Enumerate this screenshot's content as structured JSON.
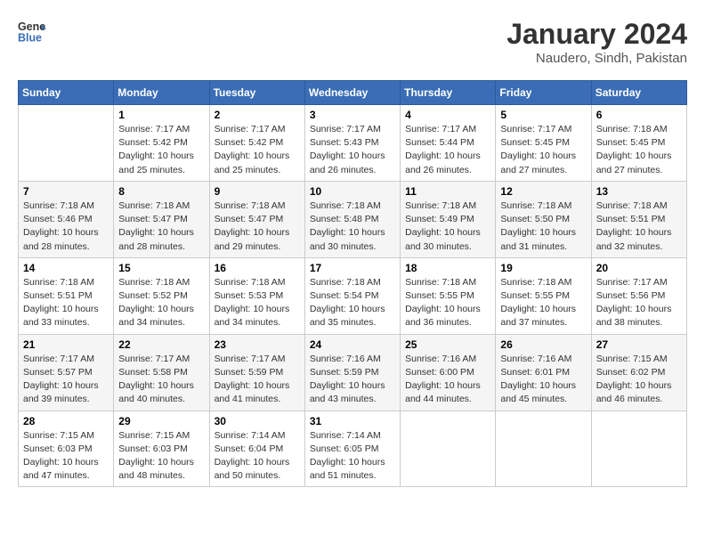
{
  "header": {
    "logo": {
      "general": "General",
      "blue": "Blue"
    },
    "title": "January 2024",
    "location": "Naudero, Sindh, Pakistan"
  },
  "weekdays": [
    "Sunday",
    "Monday",
    "Tuesday",
    "Wednesday",
    "Thursday",
    "Friday",
    "Saturday"
  ],
  "weeks": [
    [
      {
        "day": "",
        "info": ""
      },
      {
        "day": "1",
        "info": "Sunrise: 7:17 AM\nSunset: 5:42 PM\nDaylight: 10 hours\nand 25 minutes."
      },
      {
        "day": "2",
        "info": "Sunrise: 7:17 AM\nSunset: 5:42 PM\nDaylight: 10 hours\nand 25 minutes."
      },
      {
        "day": "3",
        "info": "Sunrise: 7:17 AM\nSunset: 5:43 PM\nDaylight: 10 hours\nand 26 minutes."
      },
      {
        "day": "4",
        "info": "Sunrise: 7:17 AM\nSunset: 5:44 PM\nDaylight: 10 hours\nand 26 minutes."
      },
      {
        "day": "5",
        "info": "Sunrise: 7:17 AM\nSunset: 5:45 PM\nDaylight: 10 hours\nand 27 minutes."
      },
      {
        "day": "6",
        "info": "Sunrise: 7:18 AM\nSunset: 5:45 PM\nDaylight: 10 hours\nand 27 minutes."
      }
    ],
    [
      {
        "day": "7",
        "info": "Sunrise: 7:18 AM\nSunset: 5:46 PM\nDaylight: 10 hours\nand 28 minutes."
      },
      {
        "day": "8",
        "info": "Sunrise: 7:18 AM\nSunset: 5:47 PM\nDaylight: 10 hours\nand 28 minutes."
      },
      {
        "day": "9",
        "info": "Sunrise: 7:18 AM\nSunset: 5:47 PM\nDaylight: 10 hours\nand 29 minutes."
      },
      {
        "day": "10",
        "info": "Sunrise: 7:18 AM\nSunset: 5:48 PM\nDaylight: 10 hours\nand 30 minutes."
      },
      {
        "day": "11",
        "info": "Sunrise: 7:18 AM\nSunset: 5:49 PM\nDaylight: 10 hours\nand 30 minutes."
      },
      {
        "day": "12",
        "info": "Sunrise: 7:18 AM\nSunset: 5:50 PM\nDaylight: 10 hours\nand 31 minutes."
      },
      {
        "day": "13",
        "info": "Sunrise: 7:18 AM\nSunset: 5:51 PM\nDaylight: 10 hours\nand 32 minutes."
      }
    ],
    [
      {
        "day": "14",
        "info": "Sunrise: 7:18 AM\nSunset: 5:51 PM\nDaylight: 10 hours\nand 33 minutes."
      },
      {
        "day": "15",
        "info": "Sunrise: 7:18 AM\nSunset: 5:52 PM\nDaylight: 10 hours\nand 34 minutes."
      },
      {
        "day": "16",
        "info": "Sunrise: 7:18 AM\nSunset: 5:53 PM\nDaylight: 10 hours\nand 34 minutes."
      },
      {
        "day": "17",
        "info": "Sunrise: 7:18 AM\nSunset: 5:54 PM\nDaylight: 10 hours\nand 35 minutes."
      },
      {
        "day": "18",
        "info": "Sunrise: 7:18 AM\nSunset: 5:55 PM\nDaylight: 10 hours\nand 36 minutes."
      },
      {
        "day": "19",
        "info": "Sunrise: 7:18 AM\nSunset: 5:55 PM\nDaylight: 10 hours\nand 37 minutes."
      },
      {
        "day": "20",
        "info": "Sunrise: 7:17 AM\nSunset: 5:56 PM\nDaylight: 10 hours\nand 38 minutes."
      }
    ],
    [
      {
        "day": "21",
        "info": "Sunrise: 7:17 AM\nSunset: 5:57 PM\nDaylight: 10 hours\nand 39 minutes."
      },
      {
        "day": "22",
        "info": "Sunrise: 7:17 AM\nSunset: 5:58 PM\nDaylight: 10 hours\nand 40 minutes."
      },
      {
        "day": "23",
        "info": "Sunrise: 7:17 AM\nSunset: 5:59 PM\nDaylight: 10 hours\nand 41 minutes."
      },
      {
        "day": "24",
        "info": "Sunrise: 7:16 AM\nSunset: 5:59 PM\nDaylight: 10 hours\nand 43 minutes."
      },
      {
        "day": "25",
        "info": "Sunrise: 7:16 AM\nSunset: 6:00 PM\nDaylight: 10 hours\nand 44 minutes."
      },
      {
        "day": "26",
        "info": "Sunrise: 7:16 AM\nSunset: 6:01 PM\nDaylight: 10 hours\nand 45 minutes."
      },
      {
        "day": "27",
        "info": "Sunrise: 7:15 AM\nSunset: 6:02 PM\nDaylight: 10 hours\nand 46 minutes."
      }
    ],
    [
      {
        "day": "28",
        "info": "Sunrise: 7:15 AM\nSunset: 6:03 PM\nDaylight: 10 hours\nand 47 minutes."
      },
      {
        "day": "29",
        "info": "Sunrise: 7:15 AM\nSunset: 6:03 PM\nDaylight: 10 hours\nand 48 minutes."
      },
      {
        "day": "30",
        "info": "Sunrise: 7:14 AM\nSunset: 6:04 PM\nDaylight: 10 hours\nand 50 minutes."
      },
      {
        "day": "31",
        "info": "Sunrise: 7:14 AM\nSunset: 6:05 PM\nDaylight: 10 hours\nand 51 minutes."
      },
      {
        "day": "",
        "info": ""
      },
      {
        "day": "",
        "info": ""
      },
      {
        "day": "",
        "info": ""
      }
    ]
  ]
}
